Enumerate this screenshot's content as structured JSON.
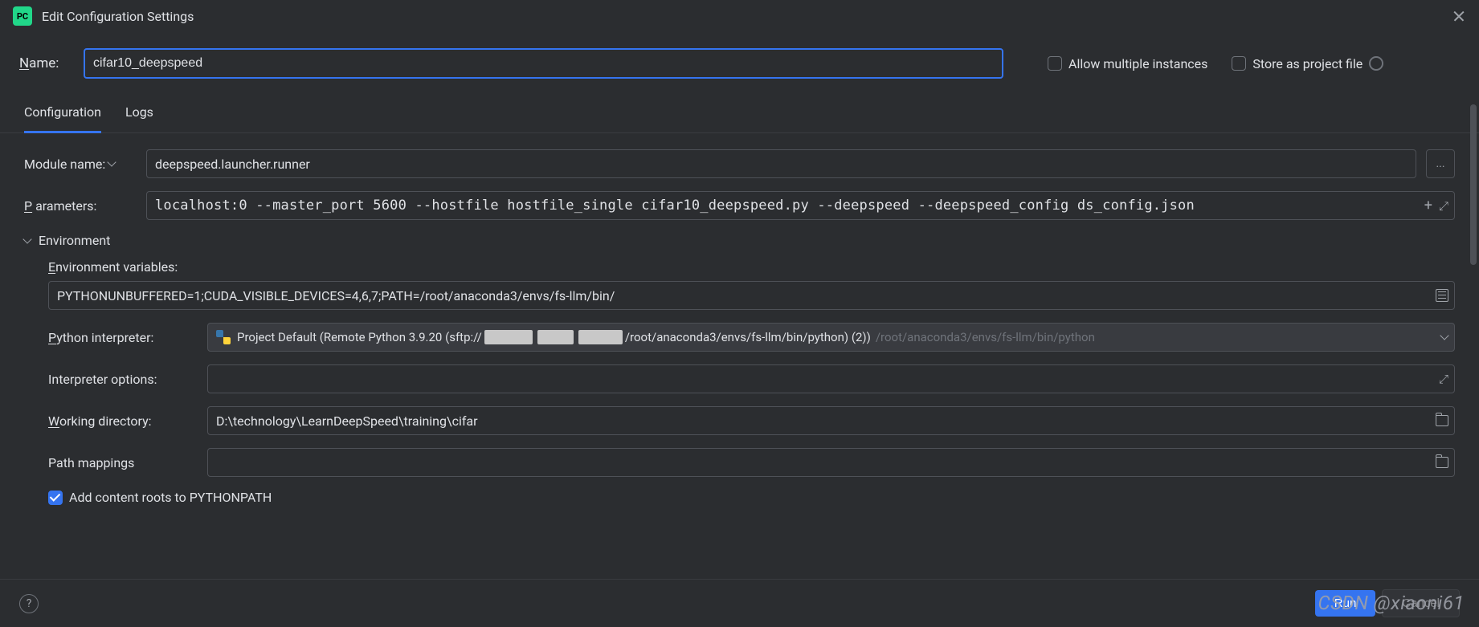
{
  "dialog": {
    "title": "Edit Configuration Settings"
  },
  "name": {
    "label_prefix": "N",
    "label_rest": "ame:",
    "value": "cifar10_deepspeed"
  },
  "options": {
    "allow_multiple": "Allow multiple instances",
    "store_project": "Store as project file"
  },
  "tabs": {
    "configuration": "Configuration",
    "logs": "Logs"
  },
  "fields": {
    "module_name": {
      "label": "Module name:",
      "value": "deepspeed.launcher.runner"
    },
    "parameters": {
      "label_prefix": "P",
      "label_rest": "arameters:",
      "value": "localhost:0 --master_port 5600 --hostfile hostfile_single cifar10_deepspeed.py --deepspeed --deepspeed_config ds_config.json"
    },
    "environment": {
      "header": "Environment",
      "env_vars": {
        "label_prefix": "E",
        "label_rest": "nvironment variables:",
        "value": "PYTHONUNBUFFERED=1;CUDA_VISIBLE_DEVICES=4,6,7;PATH=/root/anaconda3/envs/fs-llm/bin/"
      },
      "interpreter": {
        "label_prefix": "P",
        "label_rest": "ython interpreter:",
        "prefix": "Project Default (Remote Python 3.9.20 (sftp://",
        "suffix": "/root/anaconda3/envs/fs-llm/bin/python) (2))",
        "path": "/root/anaconda3/envs/fs-llm/bin/python"
      },
      "interp_options": {
        "label": "Interpreter options:",
        "value": ""
      },
      "working_dir": {
        "label_prefix": "W",
        "label_rest": "orking directory:",
        "value": "D:\\technology\\LearnDeepSpeed\\training\\cifar"
      },
      "path_mappings": {
        "label": "Path mappings",
        "value": ""
      },
      "add_content_roots": "Add content roots to PYTHONPATH"
    }
  },
  "buttons": {
    "run": "Run",
    "cancel": "Cancel"
  },
  "watermark": "CSDN @xiaoni61"
}
